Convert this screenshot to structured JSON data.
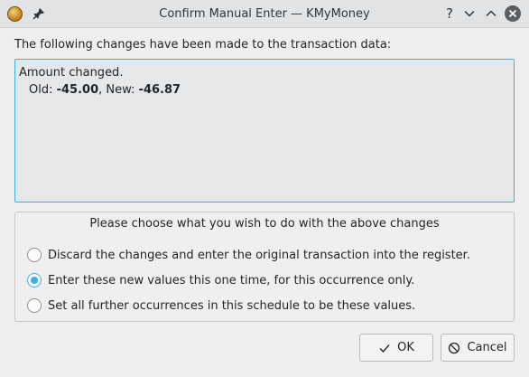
{
  "window": {
    "title": "Confirm Manual Enter — KMyMoney",
    "help_glyph": "?"
  },
  "intro": "The following changes have been made to the transaction data:",
  "changes": {
    "heading": "Amount changed.",
    "old_label": "Old: ",
    "old_value": "-45.00",
    "separator": ", New: ",
    "new_value": "-46.87"
  },
  "choice": {
    "title": "Please choose what you wish to do with the above changes",
    "options": [
      {
        "label": "Discard the changes and enter the original transaction into the register.",
        "checked": false
      },
      {
        "label": "Enter these new values this one time, for this occurrence only.",
        "checked": true
      },
      {
        "label": "Set all further occurrences in this schedule to be these values.",
        "checked": false
      }
    ]
  },
  "buttons": {
    "ok_label": "OK",
    "cancel_label": "Cancel"
  },
  "colors": {
    "accent": "#3daee9"
  }
}
